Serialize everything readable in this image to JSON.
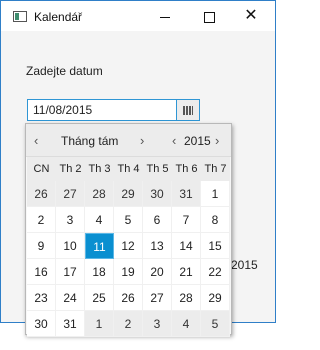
{
  "window": {
    "title": "Kalendář"
  },
  "form": {
    "prompt": "Zadejte datum",
    "date_value": "11/08/2015",
    "behind_text": "2015"
  },
  "picker": {
    "month": "Tháng tám",
    "year": "2015",
    "nav": {
      "prev": "‹",
      "next": "›"
    },
    "weekdays": [
      "CN",
      "Th 2",
      "Th 3",
      "Th 4",
      "Th 5",
      "Th 6",
      "Th 7"
    ],
    "weeks": [
      [
        {
          "d": "26",
          "o": true
        },
        {
          "d": "27",
          "o": true
        },
        {
          "d": "28",
          "o": true
        },
        {
          "d": "29",
          "o": true
        },
        {
          "d": "30",
          "o": true
        },
        {
          "d": "31",
          "o": true
        },
        {
          "d": "1"
        }
      ],
      [
        {
          "d": "2"
        },
        {
          "d": "3"
        },
        {
          "d": "4"
        },
        {
          "d": "5"
        },
        {
          "d": "6"
        },
        {
          "d": "7"
        },
        {
          "d": "8"
        }
      ],
      [
        {
          "d": "9"
        },
        {
          "d": "10"
        },
        {
          "d": "11",
          "s": true
        },
        {
          "d": "12"
        },
        {
          "d": "13"
        },
        {
          "d": "14"
        },
        {
          "d": "15"
        }
      ],
      [
        {
          "d": "16"
        },
        {
          "d": "17"
        },
        {
          "d": "18"
        },
        {
          "d": "19"
        },
        {
          "d": "20"
        },
        {
          "d": "21"
        },
        {
          "d": "22"
        }
      ],
      [
        {
          "d": "23"
        },
        {
          "d": "24"
        },
        {
          "d": "25"
        },
        {
          "d": "26"
        },
        {
          "d": "27"
        },
        {
          "d": "28"
        },
        {
          "d": "29"
        }
      ],
      [
        {
          "d": "30"
        },
        {
          "d": "31"
        },
        {
          "d": "1",
          "o": true
        },
        {
          "d": "2",
          "o": true
        },
        {
          "d": "3",
          "o": true
        },
        {
          "d": "4",
          "o": true
        },
        {
          "d": "5",
          "o": true
        }
      ]
    ]
  },
  "colors": {
    "accent": "#0a8fd0",
    "border": "#2f96d4"
  }
}
